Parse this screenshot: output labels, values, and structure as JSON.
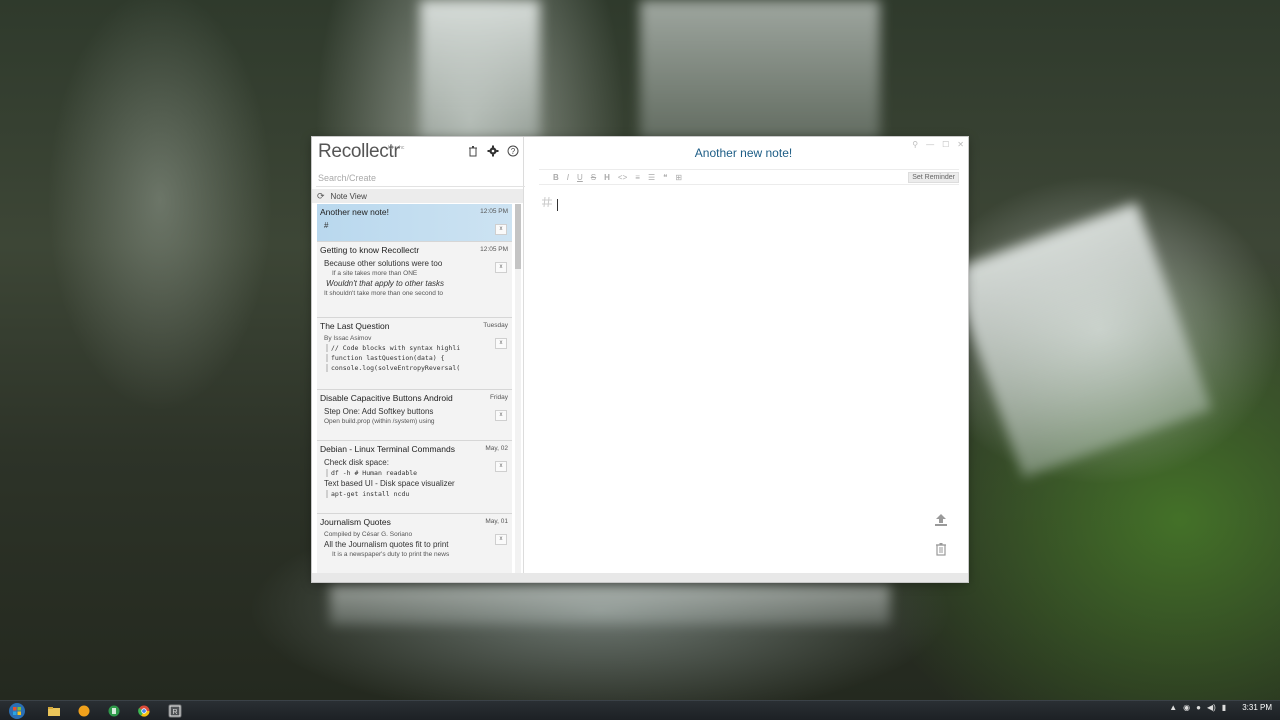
{
  "app": {
    "brand": "Recollectr",
    "brand_sub": "kit · rhc",
    "search_placeholder": "Search/Create",
    "note_view_label": "Note View"
  },
  "icons": {
    "trash": "trash-icon",
    "settings": "gear-icon",
    "help": "help-icon",
    "refresh": "refresh-icon"
  },
  "notes": [
    {
      "title": "Another new note!",
      "date": "12:05 PM",
      "lines": [
        "#"
      ]
    },
    {
      "title": "Getting to know Recollectr",
      "date": "12:05 PM",
      "lines": [
        "Because other solutions were too",
        "If a site takes more than ONE",
        "Wouldn't that apply to other tasks",
        "It shouldn't take more than one second to"
      ]
    },
    {
      "title": "The Last Question",
      "date": "Tuesday",
      "lines": [
        "By Issac Asimov",
        "// Code blocks with syntax highli",
        "function lastQuestion(data) {",
        "console.log(solveEntropyReversal("
      ]
    },
    {
      "title": "Disable Capacitive Buttons Android",
      "date": "Friday",
      "lines": [
        "Step One: Add Softkey buttons",
        "Open build.prop (within /system) using"
      ]
    },
    {
      "title": "Debian - Linux Terminal Commands",
      "date": "May, 02",
      "lines": [
        "Check disk space:",
        "df -h # Human readable",
        "Text based UI - Disk space visualizer",
        "apt-get install ncdu"
      ]
    },
    {
      "title": "Journalism Quotes",
      "date": "May, 01",
      "lines": [
        "Compiled by César G. Soriano",
        "All the Journalism quotes fit to print",
        "It is a newspaper's duty to print the news"
      ]
    }
  ],
  "note_close_label": "x",
  "editor": {
    "title": "Another new note!",
    "toolbar": [
      "B",
      "I",
      "U",
      "S",
      "H",
      "<>",
      "≡",
      "☰",
      "❝",
      "⊞"
    ],
    "set_reminder": "Set Reminder"
  },
  "window_buttons": [
    "—",
    "☐",
    "✕"
  ],
  "taskbar": {
    "time": "3:31 PM"
  }
}
